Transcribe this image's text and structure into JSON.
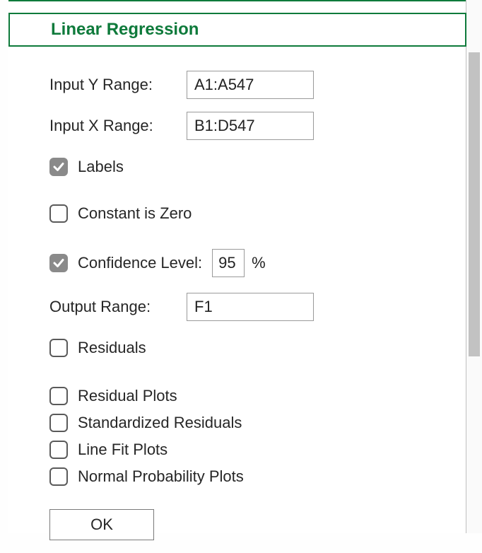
{
  "section": {
    "title": "Linear Regression"
  },
  "inputs": {
    "y_range_label": "Input Y Range:",
    "y_range_value": "A1:A547",
    "x_range_label": "Input X Range:",
    "x_range_value": "B1:D547"
  },
  "options": {
    "labels_label": "Labels",
    "labels_checked": true,
    "const_zero_label": "Constant is Zero",
    "const_zero_checked": false,
    "confidence_label": "Confidence Level:",
    "confidence_checked": true,
    "confidence_value": "95",
    "confidence_unit": "%",
    "output_range_label": "Output Range:",
    "output_range_value": "F1",
    "residuals_label": "Residuals",
    "residuals_checked": false,
    "residual_plots_label": "Residual Plots",
    "residual_plots_checked": false,
    "std_residuals_label": "Standardized Residuals",
    "std_residuals_checked": false,
    "line_fit_label": "Line Fit Plots",
    "line_fit_checked": false,
    "normal_prob_label": "Normal Probability Plots",
    "normal_prob_checked": false
  },
  "buttons": {
    "ok_label": "OK"
  }
}
